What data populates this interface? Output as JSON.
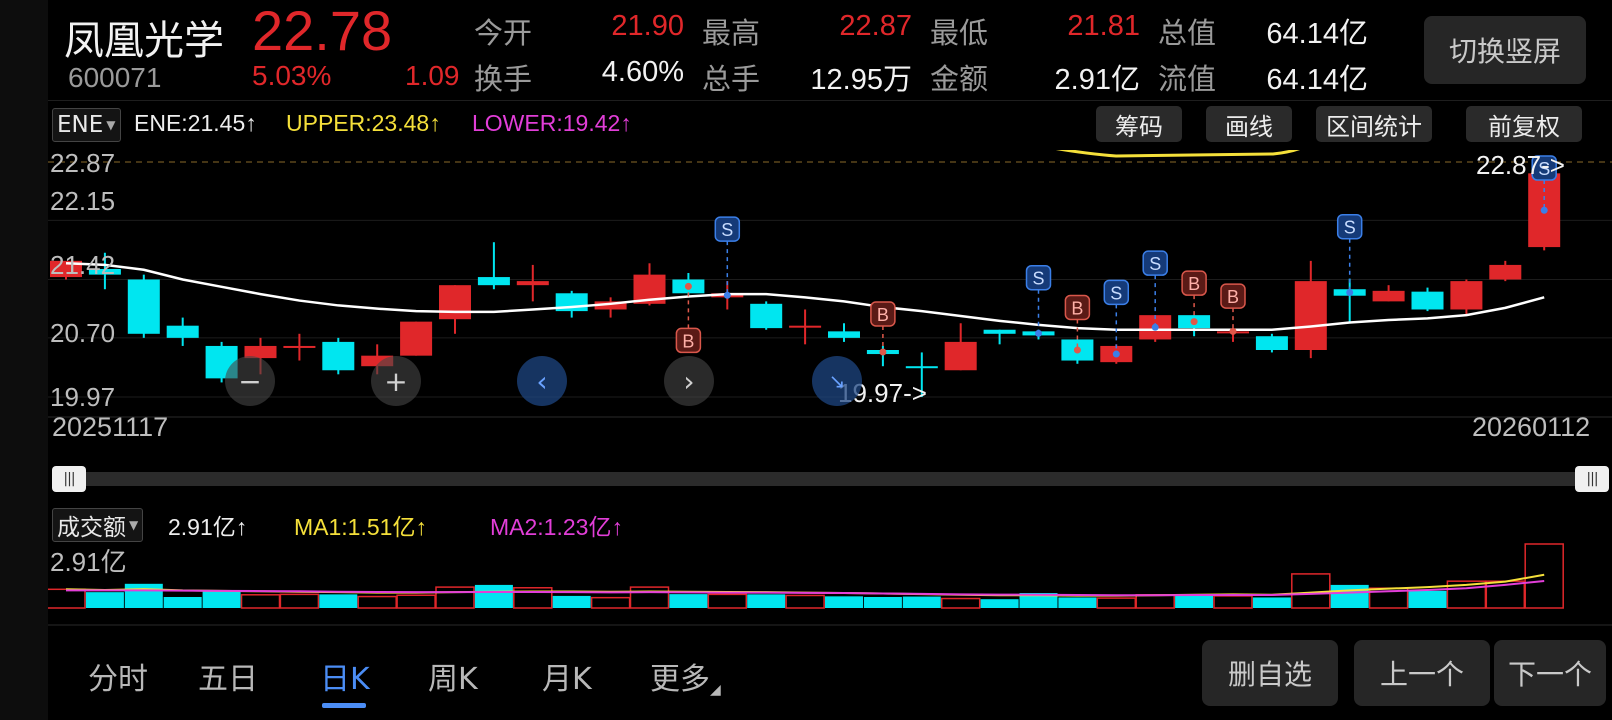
{
  "header": {
    "stock_name": "凤凰光学",
    "price": "22.78",
    "code": "600071",
    "change_pct": "5.03%",
    "change_amt": "1.09",
    "quotes": [
      {
        "label": "今开",
        "value": "21.90",
        "color": "red"
      },
      {
        "label": "最高",
        "value": "22.87",
        "color": "red"
      },
      {
        "label": "最低",
        "value": "21.81",
        "color": "red"
      },
      {
        "label": "总值",
        "value": "64.14亿",
        "color": "white"
      },
      {
        "label": "换手",
        "value": "4.60%",
        "color": "white"
      },
      {
        "label": "总手",
        "value": "12.95万",
        "color": "white"
      },
      {
        "label": "金额",
        "value": "2.91亿",
        "color": "white"
      },
      {
        "label": "流值",
        "value": "64.14亿",
        "color": "white"
      }
    ],
    "switch_button": "切换竖屏"
  },
  "indicator": {
    "name": "ENE",
    "ene": "ENE:21.45↑",
    "upper": "UPPER:23.48↑",
    "lower": "LOWER:19.42↑",
    "tools": [
      "筹码",
      "画线",
      "区间统计",
      "前复权"
    ]
  },
  "price_axis": [
    "22.87",
    "22.15",
    "21.42",
    "20.70",
    "19.97"
  ],
  "annotations": {
    "high": "22.87->",
    "low": "19.97->"
  },
  "dates": {
    "start": "20251117",
    "end": "20260112"
  },
  "volume": {
    "name": "成交额",
    "value": "2.91亿↑",
    "ma1": "MA1:1.51亿↑",
    "ma2": "MA2:1.23亿↑",
    "axis_max": "2.91亿"
  },
  "nav": {
    "tabs": [
      "分时",
      "五日",
      "日K",
      "周K",
      "月K",
      "更多"
    ],
    "active": "日K",
    "buttons": [
      "删自选",
      "上一个",
      "下一个"
    ]
  },
  "colors": {
    "up": "#e0272a",
    "down": "#00e6f0",
    "ene": "#ffffff",
    "upper": "#f5e03a",
    "lower": "#e23ed8",
    "accent": "#4b8df5"
  },
  "chart_data": {
    "type": "candlestick",
    "ylim": [
      19.97,
      22.87
    ],
    "candles": [
      {
        "o": 21.65,
        "c": 21.45,
        "h": 21.62,
        "l": 21.42,
        "dir": "up"
      },
      {
        "o": 21.55,
        "c": 21.48,
        "h": 21.75,
        "l": 21.3,
        "dir": "down"
      },
      {
        "o": 21.42,
        "c": 20.75,
        "h": 21.48,
        "l": 20.7,
        "dir": "down"
      },
      {
        "o": 20.85,
        "c": 20.7,
        "h": 20.95,
        "l": 20.6,
        "dir": "down"
      },
      {
        "o": 20.6,
        "c": 20.2,
        "h": 20.65,
        "l": 20.15,
        "dir": "down"
      },
      {
        "o": 20.45,
        "c": 20.6,
        "h": 20.7,
        "l": 20.25,
        "dir": "up"
      },
      {
        "o": 20.58,
        "c": 20.6,
        "h": 20.75,
        "l": 20.42,
        "dir": "up"
      },
      {
        "o": 20.65,
        "c": 20.3,
        "h": 20.7,
        "l": 20.25,
        "dir": "down"
      },
      {
        "o": 20.35,
        "c": 20.48,
        "h": 20.62,
        "l": 20.25,
        "dir": "up"
      },
      {
        "o": 20.48,
        "c": 20.9,
        "h": 20.9,
        "l": 20.48,
        "dir": "up"
      },
      {
        "o": 20.93,
        "c": 21.35,
        "h": 21.35,
        "l": 20.75,
        "dir": "up"
      },
      {
        "o": 21.45,
        "c": 21.35,
        "h": 21.88,
        "l": 21.3,
        "dir": "down"
      },
      {
        "o": 21.4,
        "c": 21.35,
        "h": 21.6,
        "l": 21.15,
        "dir": "up"
      },
      {
        "o": 21.25,
        "c": 21.03,
        "h": 21.28,
        "l": 20.95,
        "dir": "down"
      },
      {
        "o": 21.05,
        "c": 21.15,
        "h": 21.2,
        "l": 20.95,
        "dir": "up"
      },
      {
        "o": 21.12,
        "c": 21.48,
        "h": 21.62,
        "l": 21.1,
        "dir": "up"
      },
      {
        "o": 21.42,
        "c": 21.25,
        "h": 21.5,
        "l": 21.22,
        "dir": "down"
      },
      {
        "o": 21.25,
        "c": 21.2,
        "h": 21.4,
        "l": 21.05,
        "dir": "up"
      },
      {
        "o": 21.12,
        "c": 20.82,
        "h": 21.15,
        "l": 20.8,
        "dir": "down"
      },
      {
        "o": 20.85,
        "c": 20.85,
        "h": 21.05,
        "l": 20.62,
        "dir": "up"
      },
      {
        "o": 20.78,
        "c": 20.7,
        "h": 20.88,
        "l": 20.65,
        "dir": "down"
      },
      {
        "o": 20.55,
        "c": 20.5,
        "h": 20.6,
        "l": 20.35,
        "dir": "down"
      },
      {
        "o": 20.35,
        "c": 20.35,
        "h": 20.52,
        "l": 19.97,
        "dir": "down"
      },
      {
        "o": 20.3,
        "c": 20.65,
        "h": 20.88,
        "l": 20.3,
        "dir": "up"
      },
      {
        "o": 20.8,
        "c": 20.75,
        "h": 20.8,
        "l": 20.62,
        "dir": "down"
      },
      {
        "o": 20.78,
        "c": 20.73,
        "h": 20.8,
        "l": 20.68,
        "dir": "down"
      },
      {
        "o": 20.68,
        "c": 20.42,
        "h": 20.68,
        "l": 20.38,
        "dir": "down"
      },
      {
        "o": 20.4,
        "c": 20.6,
        "h": 20.62,
        "l": 20.38,
        "dir": "up"
      },
      {
        "o": 20.68,
        "c": 20.98,
        "h": 20.98,
        "l": 20.65,
        "dir": "up"
      },
      {
        "o": 20.98,
        "c": 20.82,
        "h": 20.98,
        "l": 20.72,
        "dir": "down"
      },
      {
        "o": 20.78,
        "c": 20.78,
        "h": 20.82,
        "l": 20.65,
        "dir": "up"
      },
      {
        "o": 20.72,
        "c": 20.55,
        "h": 20.75,
        "l": 20.52,
        "dir": "down"
      },
      {
        "o": 20.55,
        "c": 21.4,
        "h": 21.65,
        "l": 20.45,
        "dir": "up"
      },
      {
        "o": 21.3,
        "c": 21.22,
        "h": 21.43,
        "l": 20.9,
        "dir": "down"
      },
      {
        "o": 21.15,
        "c": 21.28,
        "h": 21.35,
        "l": 21.15,
        "dir": "up"
      },
      {
        "o": 21.27,
        "c": 21.05,
        "h": 21.32,
        "l": 21.03,
        "dir": "down"
      },
      {
        "o": 21.05,
        "c": 21.4,
        "h": 21.42,
        "l": 20.98,
        "dir": "up"
      },
      {
        "o": 21.42,
        "c": 21.6,
        "h": 21.65,
        "l": 21.4,
        "dir": "up"
      },
      {
        "o": 21.82,
        "c": 22.73,
        "h": 22.87,
        "l": 21.78,
        "dir": "up"
      }
    ],
    "ene": [
      21.62,
      21.6,
      21.54,
      21.42,
      21.33,
      21.24,
      21.16,
      21.1,
      21.06,
      21.03,
      21.02,
      21.02,
      21.05,
      21.08,
      21.12,
      21.17,
      21.21,
      21.24,
      21.24,
      21.2,
      21.15,
      21.08,
      21.03,
      20.97,
      20.91,
      20.86,
      20.82,
      20.8,
      20.8,
      20.8,
      20.8,
      20.8,
      20.84,
      20.89,
      20.92,
      20.94,
      20.98,
      21.07,
      21.2
    ],
    "signals": [
      {
        "i": 16,
        "type": "B"
      },
      {
        "i": 17,
        "type": "S"
      },
      {
        "i": 21,
        "type": "B"
      },
      {
        "i": 25,
        "type": "S"
      },
      {
        "i": 26,
        "type": "B"
      },
      {
        "i": 27,
        "type": "S"
      },
      {
        "i": 28,
        "type": "S"
      },
      {
        "i": 29,
        "type": "B"
      },
      {
        "i": 30,
        "type": "B"
      },
      {
        "i": 33,
        "type": "S"
      },
      {
        "i": 38,
        "type": "S"
      }
    ],
    "volume_ylim": [
      0,
      2.91
    ],
    "volumes": [
      0.85,
      0.72,
      1.1,
      0.5,
      0.78,
      0.6,
      0.62,
      0.62,
      0.52,
      0.58,
      0.95,
      1.05,
      0.92,
      0.55,
      0.47,
      0.95,
      0.63,
      0.62,
      0.62,
      0.57,
      0.53,
      0.5,
      0.52,
      0.43,
      0.4,
      0.68,
      0.48,
      0.45,
      0.6,
      0.55,
      0.55,
      0.48,
      1.55,
      1.05,
      0.9,
      0.78,
      1.22,
      1.22,
      2.91
    ],
    "ma1": [
      0.85,
      0.82,
      0.86,
      0.8,
      0.78,
      0.76,
      0.74,
      0.72,
      0.7,
      0.7,
      0.72,
      0.74,
      0.75,
      0.75,
      0.74,
      0.75,
      0.74,
      0.73,
      0.72,
      0.7,
      0.68,
      0.66,
      0.63,
      0.6,
      0.58,
      0.58,
      0.56,
      0.56,
      0.58,
      0.6,
      0.62,
      0.6,
      0.7,
      0.8,
      0.88,
      0.95,
      1.05,
      1.2,
      1.51
    ],
    "ma2": [
      0.8,
      0.8,
      0.8,
      0.79,
      0.78,
      0.77,
      0.76,
      0.74,
      0.73,
      0.72,
      0.72,
      0.73,
      0.73,
      0.72,
      0.71,
      0.72,
      0.71,
      0.7,
      0.7,
      0.69,
      0.68,
      0.66,
      0.64,
      0.62,
      0.61,
      0.6,
      0.59,
      0.58,
      0.58,
      0.59,
      0.59,
      0.59,
      0.64,
      0.7,
      0.76,
      0.82,
      0.9,
      1.05,
      1.23
    ]
  }
}
